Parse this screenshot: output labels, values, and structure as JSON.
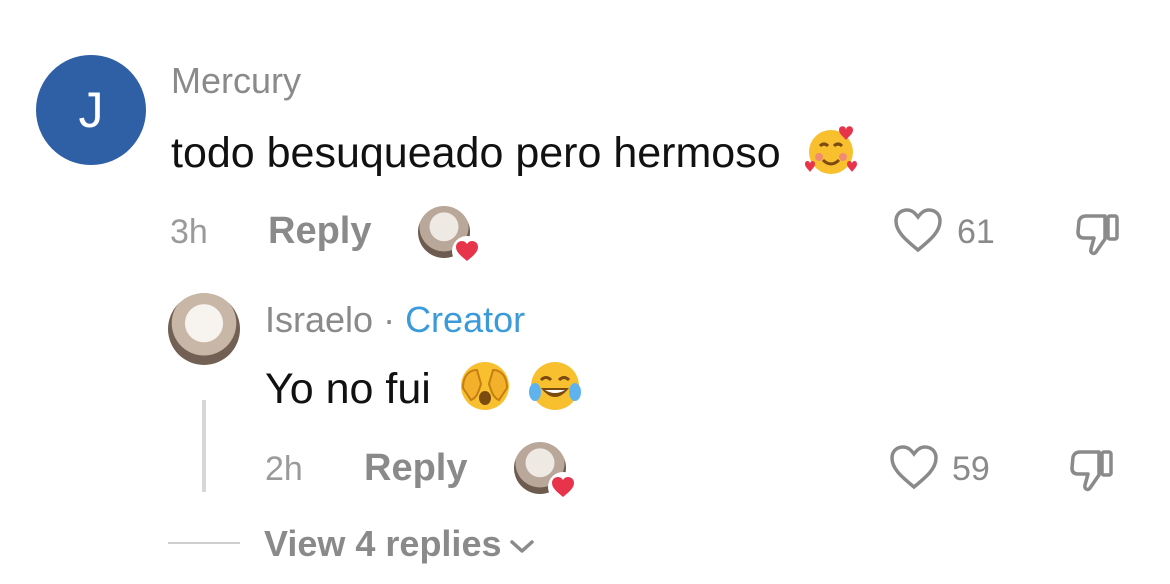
{
  "comments": [
    {
      "avatar_letter": "J",
      "username": "Mercury",
      "text": "todo besuqueado pero hermoso",
      "time": "3h",
      "reply_label": "Reply",
      "likes": "61"
    },
    {
      "username": "Israelo",
      "separator": "·",
      "badge": "Creator",
      "text": "Yo no fui",
      "time": "2h",
      "reply_label": "Reply",
      "likes": "59"
    }
  ],
  "view_replies": "View 4 replies",
  "colors": {
    "accent_creator": "#3b9ad9",
    "avatar_blue": "#2f5fa5",
    "muted": "#8a8a8a",
    "heart_badge": "#e8344b"
  }
}
